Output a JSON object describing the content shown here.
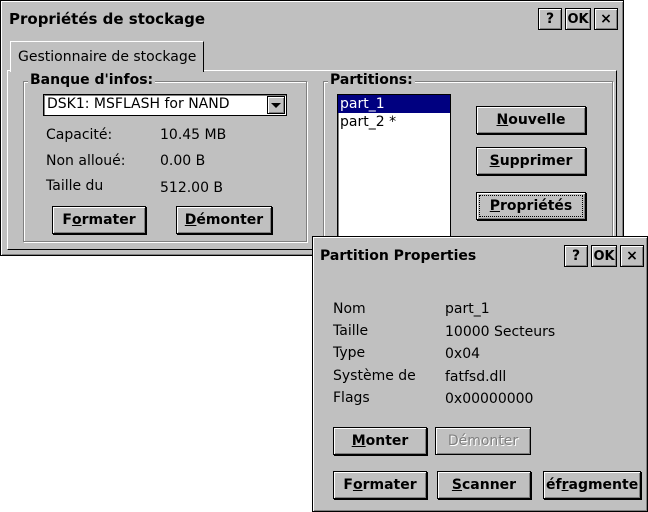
{
  "main_window": {
    "title": "Propriétés de stockage",
    "help_button": "?",
    "ok_button": "OK",
    "close_button": "×",
    "tab_label": "Gestionnaire de stockage"
  },
  "info_bank": {
    "group_label": "Banque d'infos:",
    "selected_store": "DSK1: MSFLASH for NAND",
    "rows": [
      {
        "label": "Capacité:",
        "value": "10.45 MB"
      },
      {
        "label": "Non alloué:",
        "value": "0.00 B"
      },
      {
        "label": "Taille du",
        "value": "512.00 B"
      }
    ],
    "format_pre": "F",
    "format_ul": "o",
    "format_post": "rmater",
    "unmount_ul": "D",
    "unmount_post": "émonter"
  },
  "partitions": {
    "group_label": "Partitions:",
    "items": [
      {
        "label": "part_1",
        "selected": true
      },
      {
        "label": "part_2 *",
        "selected": false
      }
    ],
    "new_ul": "N",
    "new_post": "ouvelle",
    "delete_ul": "S",
    "delete_post": "upprimer",
    "props_ul": "P",
    "props_post": "ropriétés"
  },
  "dialog": {
    "title": "Partition Properties",
    "help_button": "?",
    "ok_button": "OK",
    "close_button": "×",
    "rows": [
      {
        "label": "Nom",
        "value": "part_1"
      },
      {
        "label": "Taille",
        "value": "10000 Secteurs"
      },
      {
        "label": "Type",
        "value": "0x04"
      },
      {
        "label": "Système de",
        "value": "fatfsd.dll"
      },
      {
        "label": "Flags",
        "value": "0x00000000"
      }
    ],
    "mount_ul": "M",
    "mount_post": "onter",
    "unmount_label": "Démonter",
    "format_pre": "F",
    "format_ul": "o",
    "format_post": "rmater",
    "scan_ul": "S",
    "scan_post": "canner",
    "defrag_pre": "éf",
    "defrag_ul": "r",
    "defrag_post": "agmente"
  }
}
